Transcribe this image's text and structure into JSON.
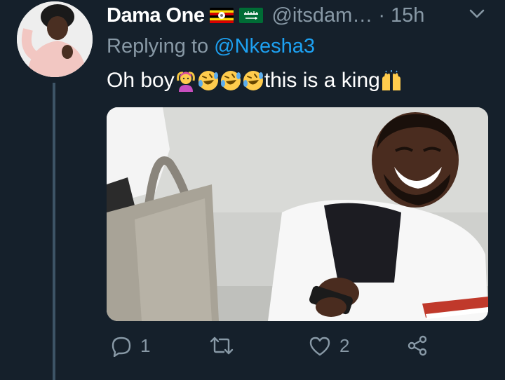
{
  "tweet": {
    "author_name": "Dama One",
    "handle": "@itsdam…",
    "separator": "·",
    "time": "15h",
    "replying_prefix": "Replying to",
    "replying_to": "@Nkesha3",
    "text_start": "Oh boy",
    "text_end": " this is a king",
    "emojis": [
      "woman-gesturing-ok-emoji",
      "rofl-emoji",
      "rofl-emoji",
      "rofl-emoji",
      "raising-hands-emoji"
    ],
    "flags": [
      "uganda-flag",
      "saudi-arabia-flag"
    ]
  },
  "actions": {
    "reply_count": "1",
    "like_count": "2"
  },
  "colors": {
    "background": "#15202b",
    "secondary_text": "#8899a6",
    "accent": "#1da1f2",
    "thread_line": "#3d5466"
  }
}
